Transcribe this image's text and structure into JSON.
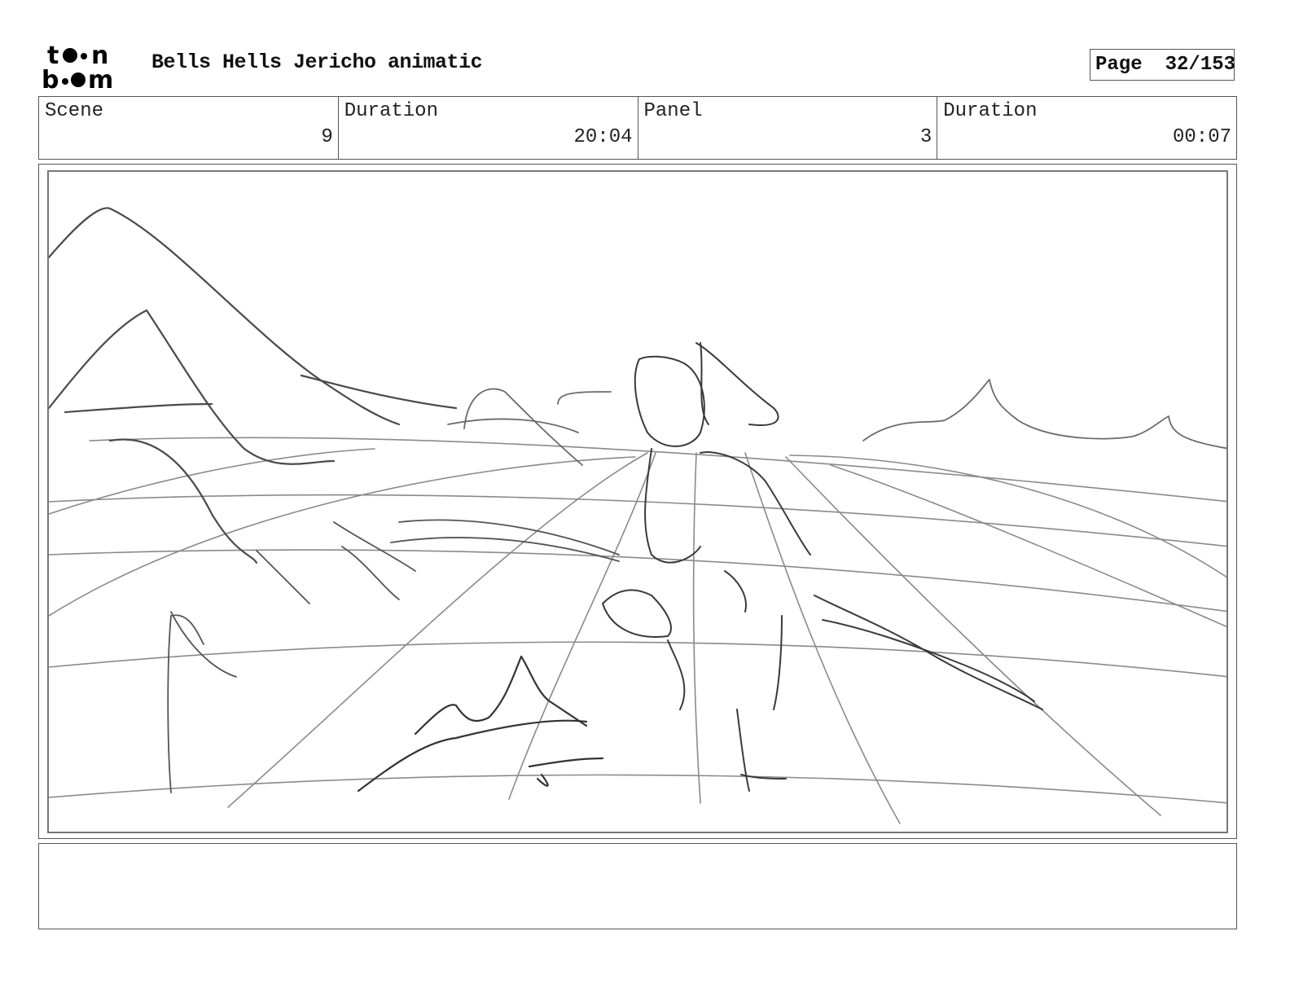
{
  "header": {
    "logo": {
      "text": "toon boom",
      "icon": "toon-boom-logo"
    },
    "project_title": "Bells Hells Jericho animatic",
    "page": {
      "label": "Page",
      "value": "32/153"
    }
  },
  "info_bar": {
    "scene": {
      "label": "Scene",
      "value": "9"
    },
    "scene_duration": {
      "label": "Duration",
      "value": "20:04"
    },
    "panel": {
      "label": "Panel",
      "value": "3"
    },
    "panel_duration": {
      "label": "Duration",
      "value": "00:07"
    }
  },
  "panel_image": {
    "icon": "storyboard-sketch",
    "colors": {
      "stroke_dark": "#3a3a3a",
      "stroke_light": "#8a8a8a"
    }
  },
  "notes": {
    "text": ""
  }
}
